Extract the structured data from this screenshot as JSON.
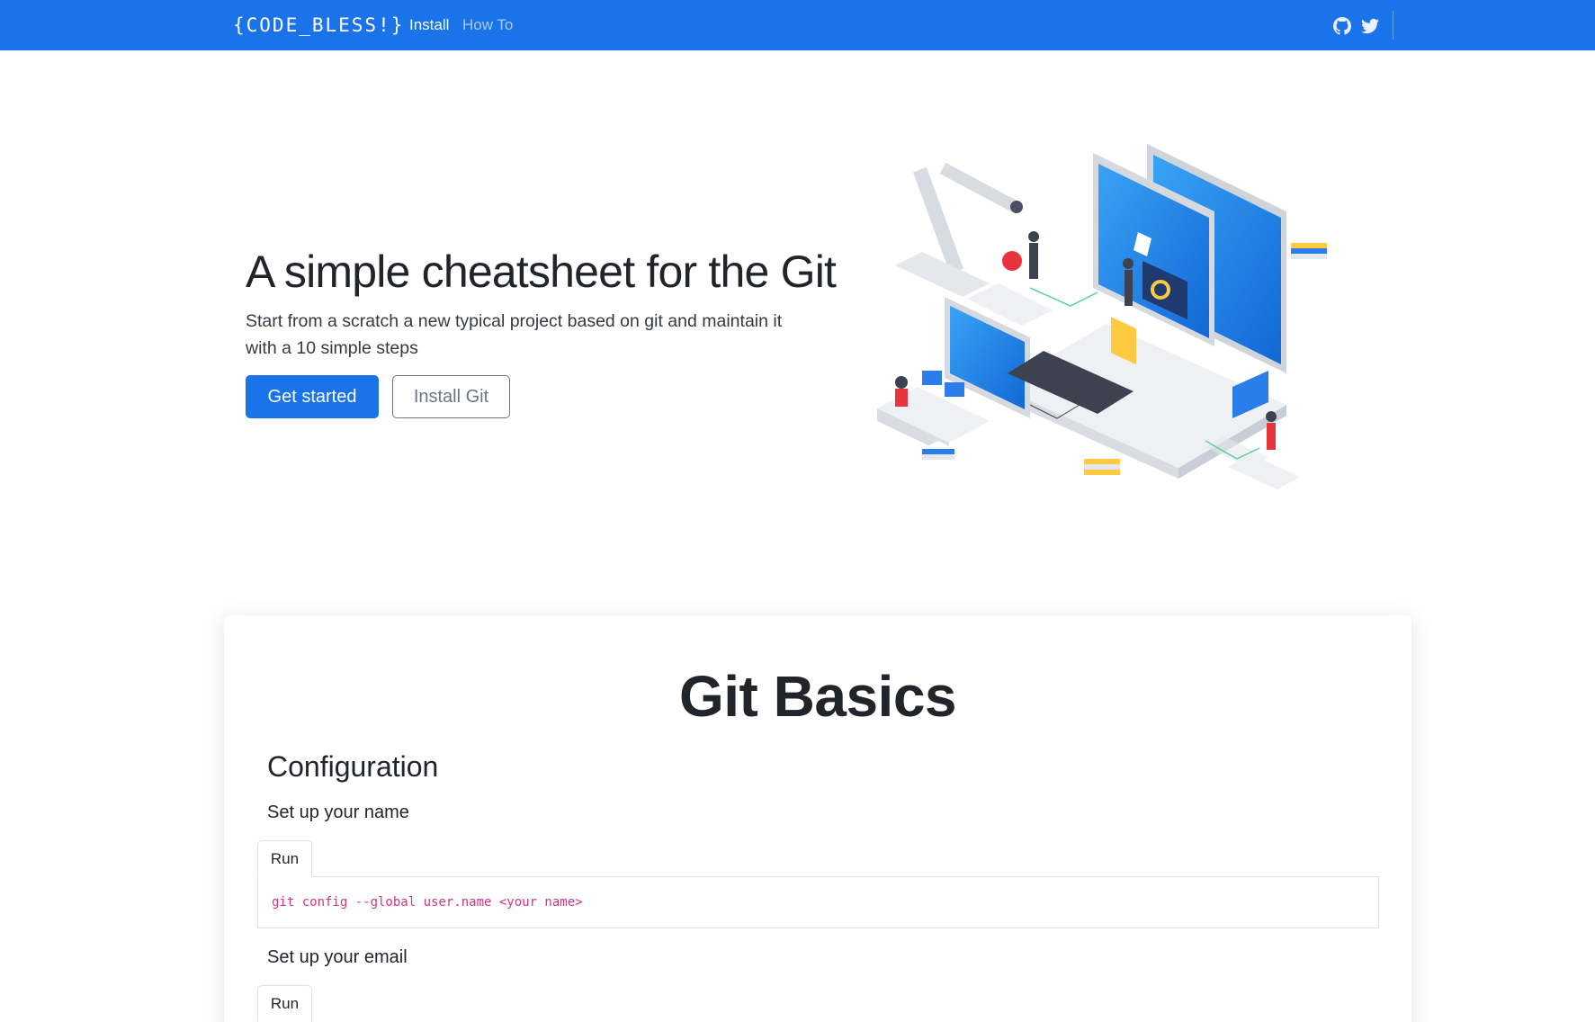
{
  "navbar": {
    "brand": "{CODE_BLESS!}",
    "links": [
      {
        "label": "Install",
        "active": true
      },
      {
        "label": "How To",
        "active": false
      }
    ],
    "icons": [
      "github-icon",
      "twitter-icon"
    ],
    "accent_color": "#1a73e8"
  },
  "hero": {
    "title": "A simple cheatsheet for the Git",
    "lead": "Start from a scratch a new typical project based on git and maintain it with a 10 simple steps",
    "primary_button": "Get started",
    "secondary_button": "Install Git"
  },
  "basics": {
    "title": "Git Basics",
    "section": "Configuration",
    "steps": [
      {
        "label": "Set up your name",
        "tab": "Run",
        "code": "git config --global user.name <your name>"
      },
      {
        "label": "Set up your email",
        "tab": "Run"
      }
    ]
  },
  "colors": {
    "code": "#d63384",
    "secondary": "#6c757d"
  }
}
